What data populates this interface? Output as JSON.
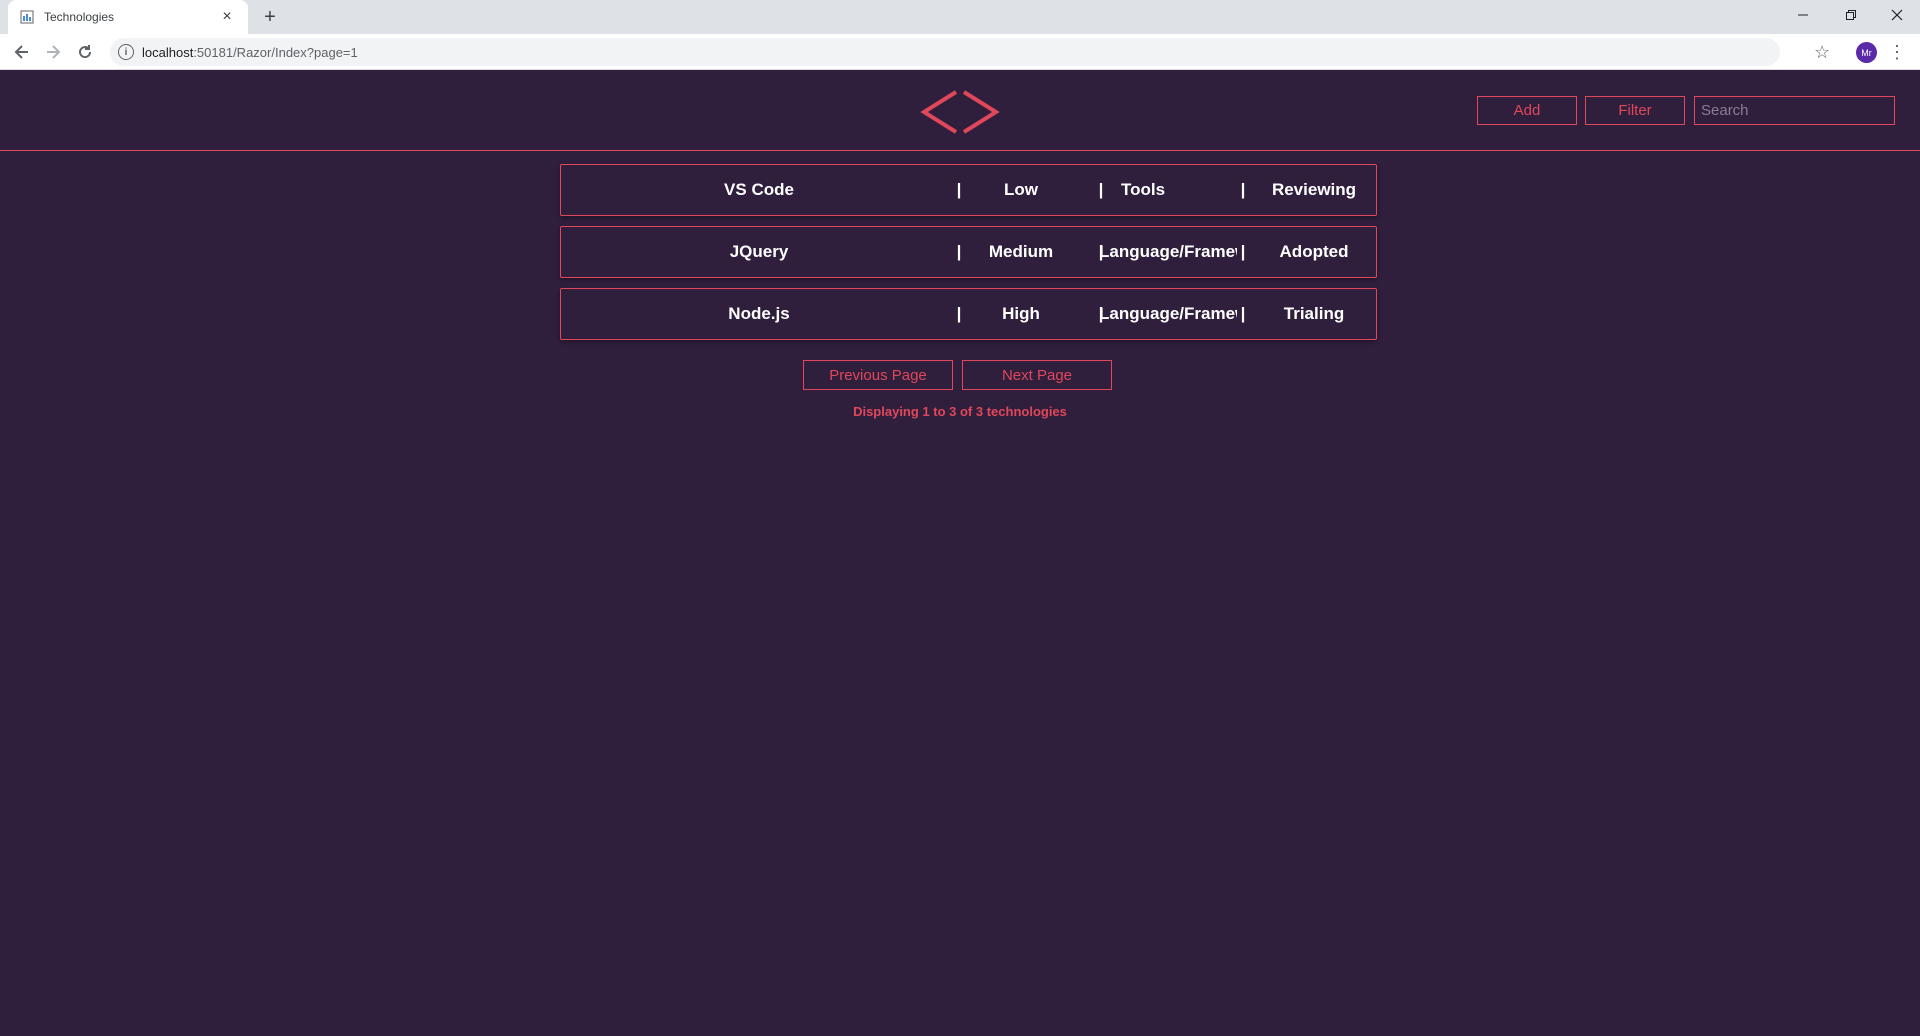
{
  "browser": {
    "tab_title": "Technologies",
    "new_tab": "+",
    "close_tab": "×",
    "url_host": "localhost",
    "url_rest": ":50181/Razor/Index?page=1",
    "avatar_initials": "Mr"
  },
  "header": {
    "add_label": "Add",
    "filter_label": "Filter",
    "search_placeholder": "Search"
  },
  "separator": "|",
  "technologies": [
    {
      "name": "VS Code",
      "level": "Low",
      "category": "Tools",
      "status": "Reviewing"
    },
    {
      "name": "JQuery",
      "level": "Medium",
      "category": "Language/Framew",
      "status": "Adopted"
    },
    {
      "name": "Node.js",
      "level": "High",
      "category": "Language/Framew",
      "status": "Trialing"
    }
  ],
  "pager": {
    "previous_label": "Previous Page",
    "next_label": "Next Page",
    "status": "Displaying 1 to 3 of 3 technologies"
  },
  "colors": {
    "background": "#2f1f3d",
    "accent": "#e0475a",
    "text": "#ffffff"
  }
}
